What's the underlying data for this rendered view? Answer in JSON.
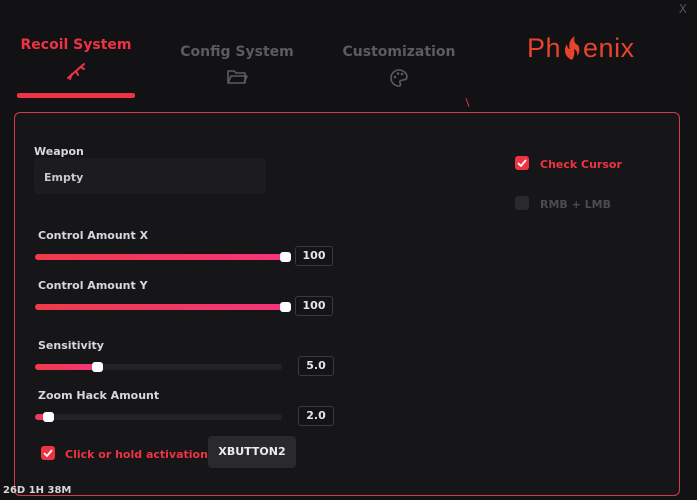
{
  "window": {
    "close_label": "X"
  },
  "tabs": [
    {
      "label": "Recoil System",
      "icon": "rifle-icon",
      "active": true
    },
    {
      "label": "Config System",
      "icon": "folder-icon",
      "active": false
    },
    {
      "label": "Customization",
      "icon": "palette-icon",
      "active": false
    }
  ],
  "logo": {
    "text_before": "Ph",
    "text_after": "enix"
  },
  "weapon": {
    "label": "Weapon",
    "value": "Empty"
  },
  "sliders": [
    {
      "label": "Control Amount X",
      "value": "100",
      "fill_fraction": 1.0
    },
    {
      "label": "Control Amount Y",
      "value": "100",
      "fill_fraction": 1.0
    },
    {
      "label": "Sensitivity",
      "value": "5.0",
      "fill_fraction": 0.24
    },
    {
      "label": "Zoom Hack Amount",
      "value": "2.0",
      "fill_fraction": 0.04
    }
  ],
  "checkboxes": {
    "check_cursor": {
      "label": "Check Cursor",
      "checked": true
    },
    "rmb_lmb": {
      "label": "RMB + LMB",
      "checked": false
    },
    "click_hold": {
      "label": "Click or hold activation",
      "checked": true
    }
  },
  "keybind": {
    "value": "XBUTTON2"
  },
  "footer": {
    "license_time": "26D 1H 38M"
  },
  "colors": {
    "accent": "#ee3344",
    "logo": "#e8432b",
    "background": "#121214",
    "panel_border": "#d63a48"
  }
}
